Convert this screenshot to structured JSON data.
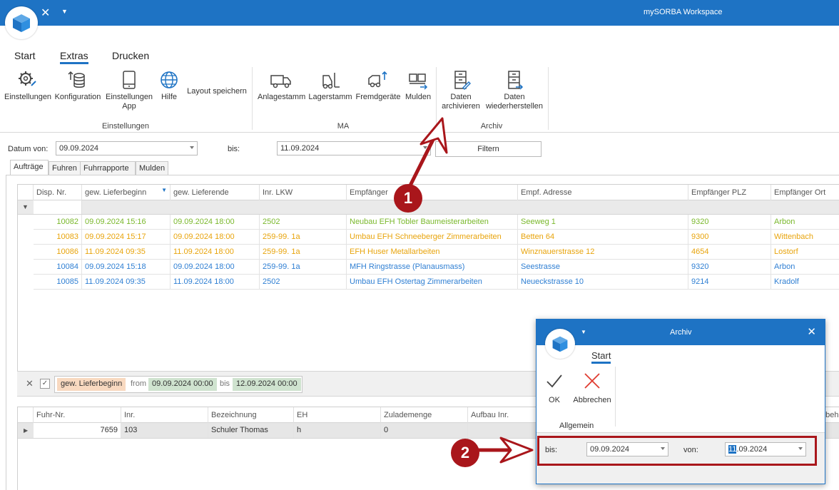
{
  "titlebar": {
    "app_title": "mySORBA Workspace"
  },
  "ribbon": {
    "tabs": [
      {
        "label": "Start"
      },
      {
        "label": "Extras"
      },
      {
        "label": "Drucken"
      }
    ],
    "buttons": {
      "einstellungen": "Einstellungen",
      "konfiguration": "Konfiguration",
      "einstellungen_app": "Einstellungen App",
      "hilfe": "Hilfe",
      "layout_speichern": "Layout speichern",
      "anlagestamm": "Anlagestamm",
      "lagerstamm": "Lagerstamm",
      "fremdgeraete": "Fremdgeräte",
      "mulden": "Mulden",
      "daten_archivieren_1": "Daten",
      "daten_archivieren_2": "archivieren",
      "daten_wiederherstellen_1": "Daten",
      "daten_wiederherstellen_2": "wiederherstellen",
      "einstellungen_app_1": "Einstellungen",
      "einstellungen_app_2": "App"
    },
    "groups": {
      "einstellungen": "Einstellungen",
      "ma": "MA",
      "archiv": "Archiv"
    }
  },
  "filter": {
    "datum_von_label": "Datum von:",
    "datum_von_value": "09.09.2024",
    "bis_label": "bis:",
    "bis_value": "11.09.2024",
    "filtern_button": "Filtern"
  },
  "tabs": [
    {
      "label": "Aufträge"
    },
    {
      "label": "Fuhren"
    },
    {
      "label": "Fuhrrapporte"
    },
    {
      "label": "Mulden"
    }
  ],
  "grid": {
    "columns": [
      "Disp. Nr.",
      "gew. Lieferbeginn",
      "gew. Lieferende",
      "Inr. LKW",
      "Empfänger",
      "Empf. Adresse",
      "Empfänger PLZ",
      "Empfänger Ort"
    ],
    "rows": [
      {
        "color": "#7ab82c",
        "cells": [
          "10082",
          "09.09.2024 15:16",
          "09.09.2024 18:00",
          "2502",
          "Neubau EFH Tobler Baumeisterarbeiten",
          "Seeweg 1",
          "9320",
          "Arbon"
        ]
      },
      {
        "color": "#e8a40c",
        "cells": [
          "10083",
          "09.09.2024 15:17",
          "09.09.2024 18:00",
          "259-99. 1a",
          "Umbau EFH Schneeberger Zimmerarbeiten",
          "Betten 64",
          "9300",
          "Wittenbach"
        ]
      },
      {
        "color": "#e8a40c",
        "cells": [
          "10086",
          "11.09.2024 09:35",
          "11.09.2024 18:00",
          "259-99. 1a",
          "EFH Huser Metallarbeiten",
          "Winznauerstrasse 12",
          "4654",
          "Lostorf"
        ]
      },
      {
        "color": "#2f7fd3",
        "cells": [
          "10084",
          "09.09.2024 15:18",
          "09.09.2024 18:00",
          "259-99. 1a",
          "MFH Ringstrasse (Planausmass)",
          "Seestrasse",
          "9320",
          "Arbon"
        ]
      },
      {
        "color": "#2f7fd3",
        "cells": [
          "10085",
          "11.09.2024 09:35",
          "11.09.2024 18:00",
          "2502",
          "Umbau EFH Ostertag Zimmerarbeiten",
          "Neueckstrasse 10",
          "9214",
          "Kradolf"
        ]
      }
    ]
  },
  "filter_panel": {
    "field": "gew. Lieferbeginn",
    "from_label": "from",
    "from_value": "09.09.2024 00:00",
    "bis_label": "bis",
    "bis_value": "12.09.2024 00:00"
  },
  "grid2": {
    "columns": [
      "Fuhr-Nr.",
      "Inr.",
      "Bezeichnung",
      "EH",
      "Zulademenge",
      "Aufbau Inr.",
      "ubeh"
    ],
    "row": [
      "7659",
      "103",
      "Schuler Thomas",
      "h",
      "0"
    ]
  },
  "dialog": {
    "title": "Archiv",
    "tab": "Start",
    "ok_label": "OK",
    "abbrechen_label": "Abbrechen",
    "group_label": "Allgemein",
    "bis_label": "bis:",
    "bis_value": "09.09.2024",
    "von_label": "von:",
    "von_value_selected": "11",
    "von_value_rest": ".09.2024"
  },
  "annotations": {
    "badge1": "1",
    "badge2": "2"
  },
  "colors": {
    "accent": "#1e73c4",
    "annotation": "#a9161b"
  }
}
